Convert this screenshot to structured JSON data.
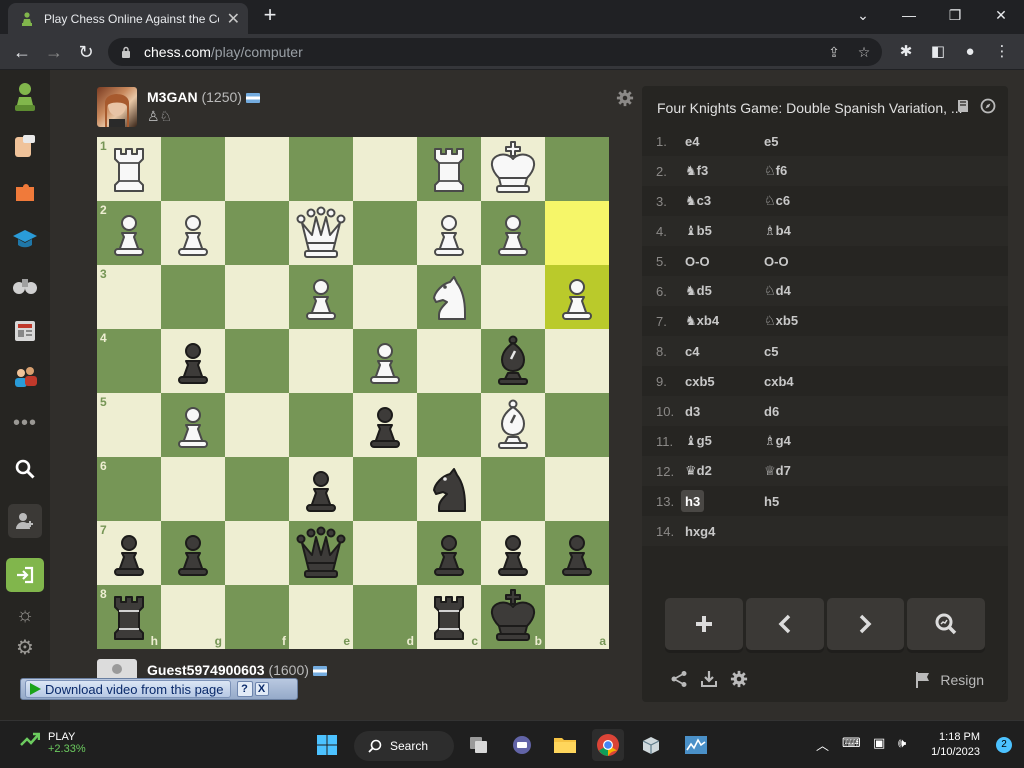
{
  "browser": {
    "tab_title": "Play Chess Online Against the Co",
    "url_domain": "chess.com",
    "url_path": "/play/computer"
  },
  "opponent": {
    "name": "M3GAN",
    "rating": "(1250)",
    "captured": "♙♘"
  },
  "player": {
    "name": "Guest5974900603",
    "rating": "(1600)"
  },
  "board": {
    "ranks": [
      "1",
      "2",
      "3",
      "4",
      "5",
      "6",
      "7",
      "8"
    ],
    "files": [
      "h",
      "g",
      "f",
      "e",
      "d",
      "c",
      "b",
      "a"
    ],
    "light": "#eeeed2",
    "dark": "#769656",
    "highlight_light": "#f6f669",
    "highlight_dark": "#baca2b",
    "pieces": [
      {
        "sq": "b1",
        "p": "wK"
      },
      {
        "sq": "c1",
        "p": "wR"
      },
      {
        "sq": "h1",
        "p": "wR"
      },
      {
        "sq": "b2",
        "p": "wP"
      },
      {
        "sq": "c2",
        "p": "wP"
      },
      {
        "sq": "e2",
        "p": "wQ"
      },
      {
        "sq": "g2",
        "p": "wP"
      },
      {
        "sq": "h2",
        "p": "wP"
      },
      {
        "sq": "a3",
        "p": "wP"
      },
      {
        "sq": "c3",
        "p": "wN"
      },
      {
        "sq": "e3",
        "p": "wP"
      },
      {
        "sq": "b4",
        "p": "bB"
      },
      {
        "sq": "d4",
        "p": "wP"
      },
      {
        "sq": "g4",
        "p": "bP"
      },
      {
        "sq": "b5",
        "p": "wB"
      },
      {
        "sq": "d5",
        "p": "bP"
      },
      {
        "sq": "g5",
        "p": "wP"
      },
      {
        "sq": "c6",
        "p": "bN"
      },
      {
        "sq": "e6",
        "p": "bP"
      },
      {
        "sq": "a7",
        "p": "bP"
      },
      {
        "sq": "b7",
        "p": "bP"
      },
      {
        "sq": "c7",
        "p": "bP"
      },
      {
        "sq": "e7",
        "p": "bQ"
      },
      {
        "sq": "g7",
        "p": "bP"
      },
      {
        "sq": "h7",
        "p": "bP"
      },
      {
        "sq": "b8",
        "p": "bK"
      },
      {
        "sq": "c8",
        "p": "bR"
      },
      {
        "sq": "h8",
        "p": "bR"
      }
    ],
    "highlights": [
      "a2",
      "a3"
    ]
  },
  "opening": "Four Knights Game: Double Spanish Variation, ...",
  "moves": [
    {
      "n": "1.",
      "w": "e4",
      "wi": "",
      "b": "e5",
      "bi": ""
    },
    {
      "n": "2.",
      "w": "f3",
      "wi": "♞",
      "b": "f6",
      "bi": "♘"
    },
    {
      "n": "3.",
      "w": "c3",
      "wi": "♞",
      "b": "c6",
      "bi": "♘"
    },
    {
      "n": "4.",
      "w": "b5",
      "wi": "♝",
      "b": "b4",
      "bi": "♗"
    },
    {
      "n": "5.",
      "w": "O-O",
      "wi": "",
      "b": "O-O",
      "bi": ""
    },
    {
      "n": "6.",
      "w": "d5",
      "wi": "♞",
      "b": "d4",
      "bi": "♘"
    },
    {
      "n": "7.",
      "w": "xb4",
      "wi": "♞",
      "b": "xb5",
      "bi": "♘"
    },
    {
      "n": "8.",
      "w": "c4",
      "wi": "",
      "b": "c5",
      "bi": ""
    },
    {
      "n": "9.",
      "w": "cxb5",
      "wi": "",
      "b": "cxb4",
      "bi": ""
    },
    {
      "n": "10.",
      "w": "d3",
      "wi": "",
      "b": "d6",
      "bi": ""
    },
    {
      "n": "11.",
      "w": "g5",
      "wi": "♝",
      "b": "g4",
      "bi": "♗"
    },
    {
      "n": "12.",
      "w": "d2",
      "wi": "♛",
      "b": "d7",
      "bi": "♕"
    },
    {
      "n": "13.",
      "w": "h3",
      "wi": "",
      "b": "h5",
      "bi": "",
      "current": "w"
    },
    {
      "n": "14.",
      "w": "hxg4",
      "wi": "",
      "b": "",
      "bi": ""
    }
  ],
  "resign_label": "Resign",
  "download_bar": {
    "label": "Download video from this page",
    "help": "?",
    "close": "X"
  },
  "taskbar": {
    "stock_name": "PLAY",
    "stock_change": "+2.33%",
    "search_label": "Search",
    "time": "1:18 PM",
    "date": "1/10/2023",
    "notifications": "2"
  }
}
